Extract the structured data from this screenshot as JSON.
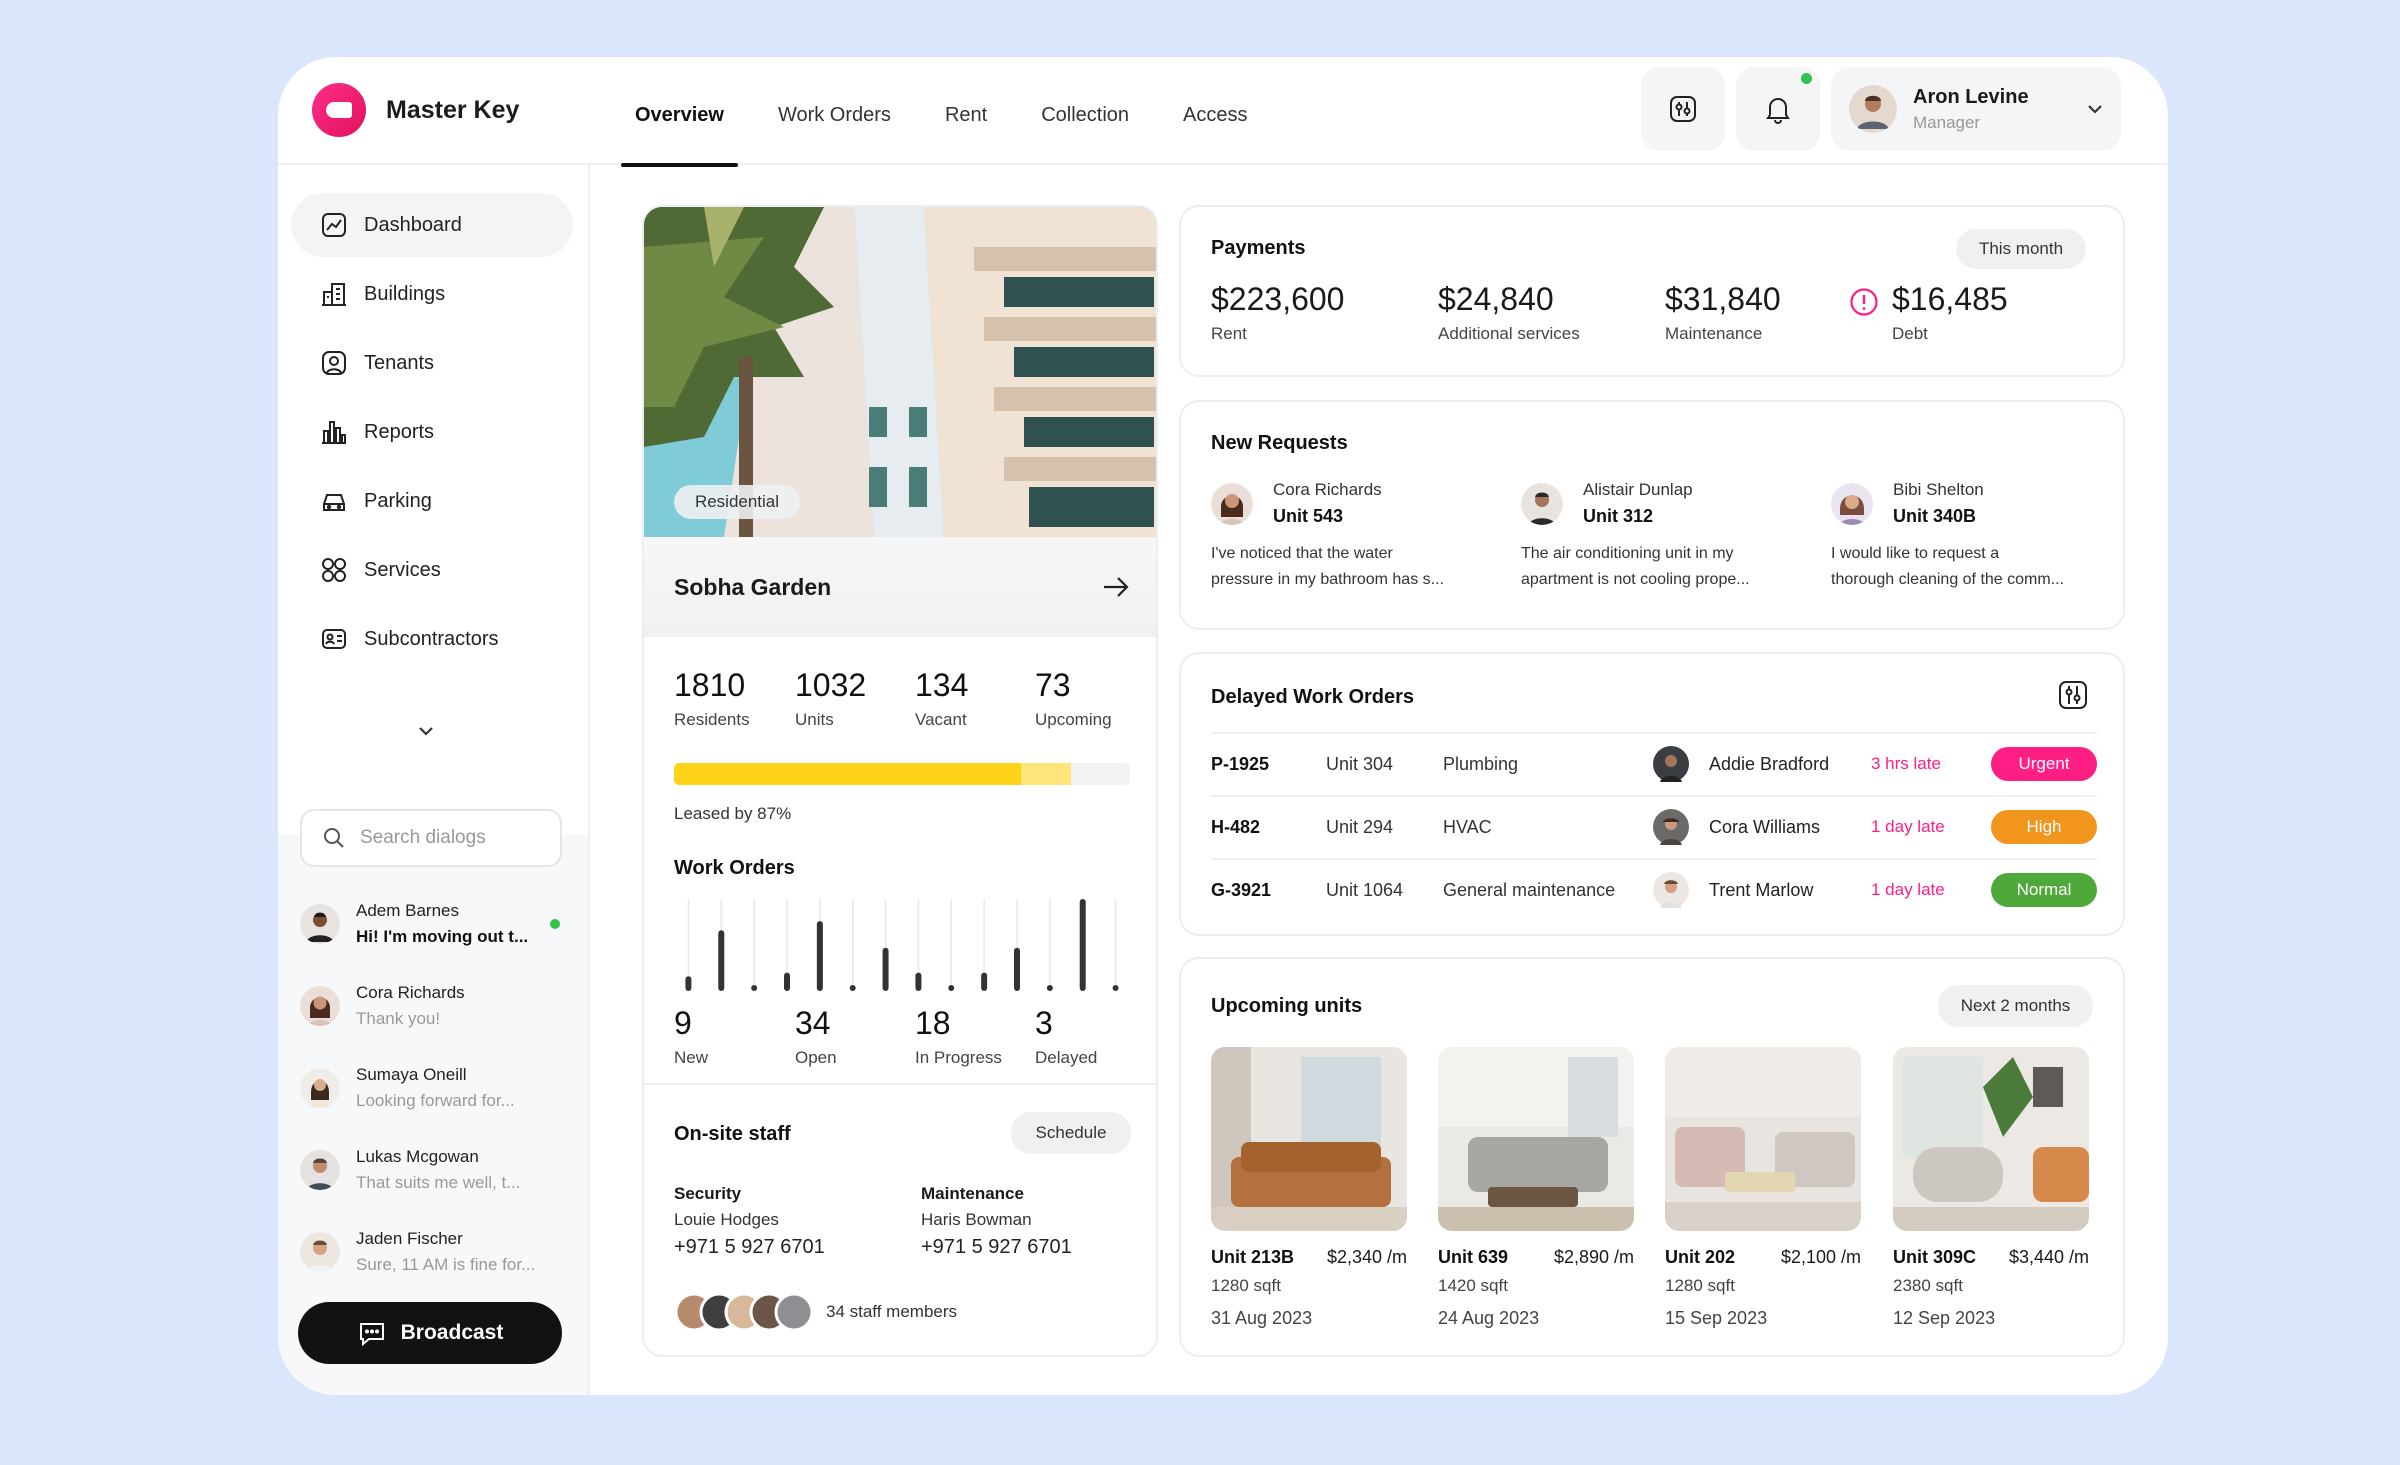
{
  "app": {
    "name": "Master Key"
  },
  "nav_tabs": [
    "Overview",
    "Work Orders",
    "Rent",
    "Collection",
    "Access"
  ],
  "user": {
    "name": "Aron Levine",
    "role": "Manager"
  },
  "sidebar": {
    "items": [
      {
        "label": "Dashboard",
        "icon": "chart-icon"
      },
      {
        "label": "Buildings",
        "icon": "buildings-icon"
      },
      {
        "label": "Tenants",
        "icon": "tenant-icon"
      },
      {
        "label": "Reports",
        "icon": "bar-chart-icon"
      },
      {
        "label": "Parking",
        "icon": "car-icon"
      },
      {
        "label": "Services",
        "icon": "grid-icon"
      },
      {
        "label": "Subcontractors",
        "icon": "id-card-icon"
      }
    ],
    "search_placeholder": "Search dialogs",
    "dialogs": [
      {
        "name": "Adem Barnes",
        "message": "Hi! I'm moving out t...",
        "unread": true
      },
      {
        "name": "Cora Richards",
        "message": "Thank you!"
      },
      {
        "name": "Sumaya Oneill",
        "message": "Looking forward for..."
      },
      {
        "name": "Lukas Mcgowan",
        "message": "That suits me well, t..."
      },
      {
        "name": "Jaden Fischer",
        "message": "Sure, 11 AM is fine for..."
      }
    ],
    "broadcast_label": "Broadcast"
  },
  "building": {
    "tag": "Residential",
    "name": "Sobha Garden",
    "stats": [
      {
        "value": "1810",
        "label": "Residents"
      },
      {
        "value": "1032",
        "label": "Units"
      },
      {
        "value": "134",
        "label": "Vacant"
      },
      {
        "value": "73",
        "label": "Upcoming"
      }
    ],
    "leased_label": "Leased by 87%",
    "leased_fraction": 0.87,
    "leased_solid_fraction": 0.76,
    "work_orders_title": "Work Orders",
    "work_order_bars": [
      0.16,
      0.66,
      0.04,
      0.2,
      0.76,
      0.04,
      0.47,
      0.2,
      0.04,
      0.2,
      0.47,
      0.04,
      1.0,
      0.04
    ],
    "work_order_stats": [
      {
        "value": "9",
        "label": "New"
      },
      {
        "value": "34",
        "label": "Open"
      },
      {
        "value": "18",
        "label": "In Progress"
      },
      {
        "value": "3",
        "label": "Delayed"
      }
    ],
    "staff_title": "On-site staff",
    "schedule_label": "Schedule",
    "staff": [
      {
        "role": "Security",
        "name": "Louie Hodges",
        "phone": "+971 5 927 6701"
      },
      {
        "role": "Maintenance",
        "name": "Haris Bowman",
        "phone": "+971 5 927 6701"
      }
    ],
    "staff_count": "34 staff members"
  },
  "payments": {
    "title": "Payments",
    "period": "This month",
    "items": [
      {
        "value": "$223,600",
        "label": "Rent"
      },
      {
        "value": "$24,840",
        "label": "Additional services"
      },
      {
        "value": "$31,840",
        "label": "Maintenance"
      },
      {
        "value": "$16,485",
        "label": "Debt"
      }
    ]
  },
  "requests": {
    "title": "New Requests",
    "items": [
      {
        "name": "Cora Richards",
        "unit": "Unit 543",
        "text1": "I've noticed that the water",
        "text2": "pressure in my bathroom has s..."
      },
      {
        "name": "Alistair Dunlap",
        "unit": "Unit 312",
        "text1": "The air conditioning unit in my",
        "text2": "apartment is not cooling prope..."
      },
      {
        "name": "Bibi Shelton",
        "unit": "Unit 340B",
        "text1": "I would like to request a",
        "text2": "thorough cleaning of the comm..."
      }
    ]
  },
  "delayed": {
    "title": "Delayed Work Orders",
    "rows": [
      {
        "id": "P-1925",
        "unit": "Unit 304",
        "type": "Plumbing",
        "person": "Addie Bradford",
        "late": "3 hrs late",
        "priority": "Urgent",
        "color": "#ff1f84"
      },
      {
        "id": "H-482",
        "unit": "Unit 294",
        "type": "HVAC",
        "person": "Cora Williams",
        "late": "1 day late",
        "priority": "High",
        "color": "#f2951c"
      },
      {
        "id": "G-3921",
        "unit": "Unit 1064",
        "type": "General maintenance",
        "person": "Trent Marlow",
        "late": "1 day late",
        "priority": "Normal",
        "color": "#4ea83a"
      }
    ]
  },
  "upcoming": {
    "title": "Upcoming units",
    "period": "Next 2 months",
    "units": [
      {
        "name": "Unit 213B",
        "price": "$2,340 /m",
        "size": "1280 sqft",
        "date": "31 Aug 2023"
      },
      {
        "name": "Unit 639",
        "price": "$2,890 /m",
        "size": "1420 sqft",
        "date": "24 Aug 2023"
      },
      {
        "name": "Unit 202",
        "price": "$2,100 /m",
        "size": "1280 sqft",
        "date": "15 Sep 2023"
      },
      {
        "name": "Unit 309C",
        "price": "$3,440 /m",
        "size": "2380 sqft",
        "date": "12 Sep 2023"
      }
    ]
  },
  "colors": {
    "accent": "#ff1f84",
    "leased": "#ffd31a",
    "leased_light": "#ffe47a",
    "online": "#33c24d"
  }
}
